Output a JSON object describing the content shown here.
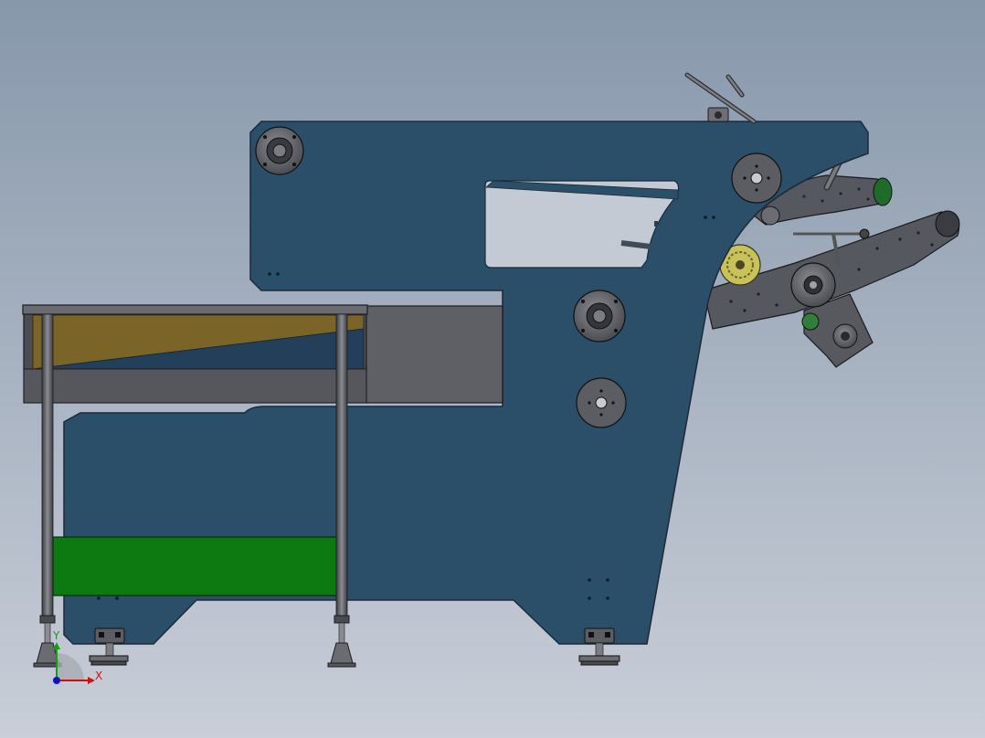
{
  "viewport": {
    "background_top": "#8798ab",
    "background_bottom": "#c9ced8"
  },
  "colors": {
    "frame_blue": "#2b4e69",
    "frame_edge": "#1a2a38",
    "steel_gray": "#5e6066",
    "dark_gray": "#3f4145",
    "tray_mustard": "#7a6428",
    "tray_blue": "#233f5a",
    "green_panel": "#0c7a10",
    "arm_gray": "#56585f",
    "bearing_gray": "#6b6d73",
    "gear_yellow": "#c9c25a",
    "window_light": "#c4cad4"
  },
  "triad": {
    "x_label": "X",
    "y_label": "Y",
    "x_color": "#d01010",
    "y_color": "#10a010",
    "z_color": "#1010c0"
  }
}
